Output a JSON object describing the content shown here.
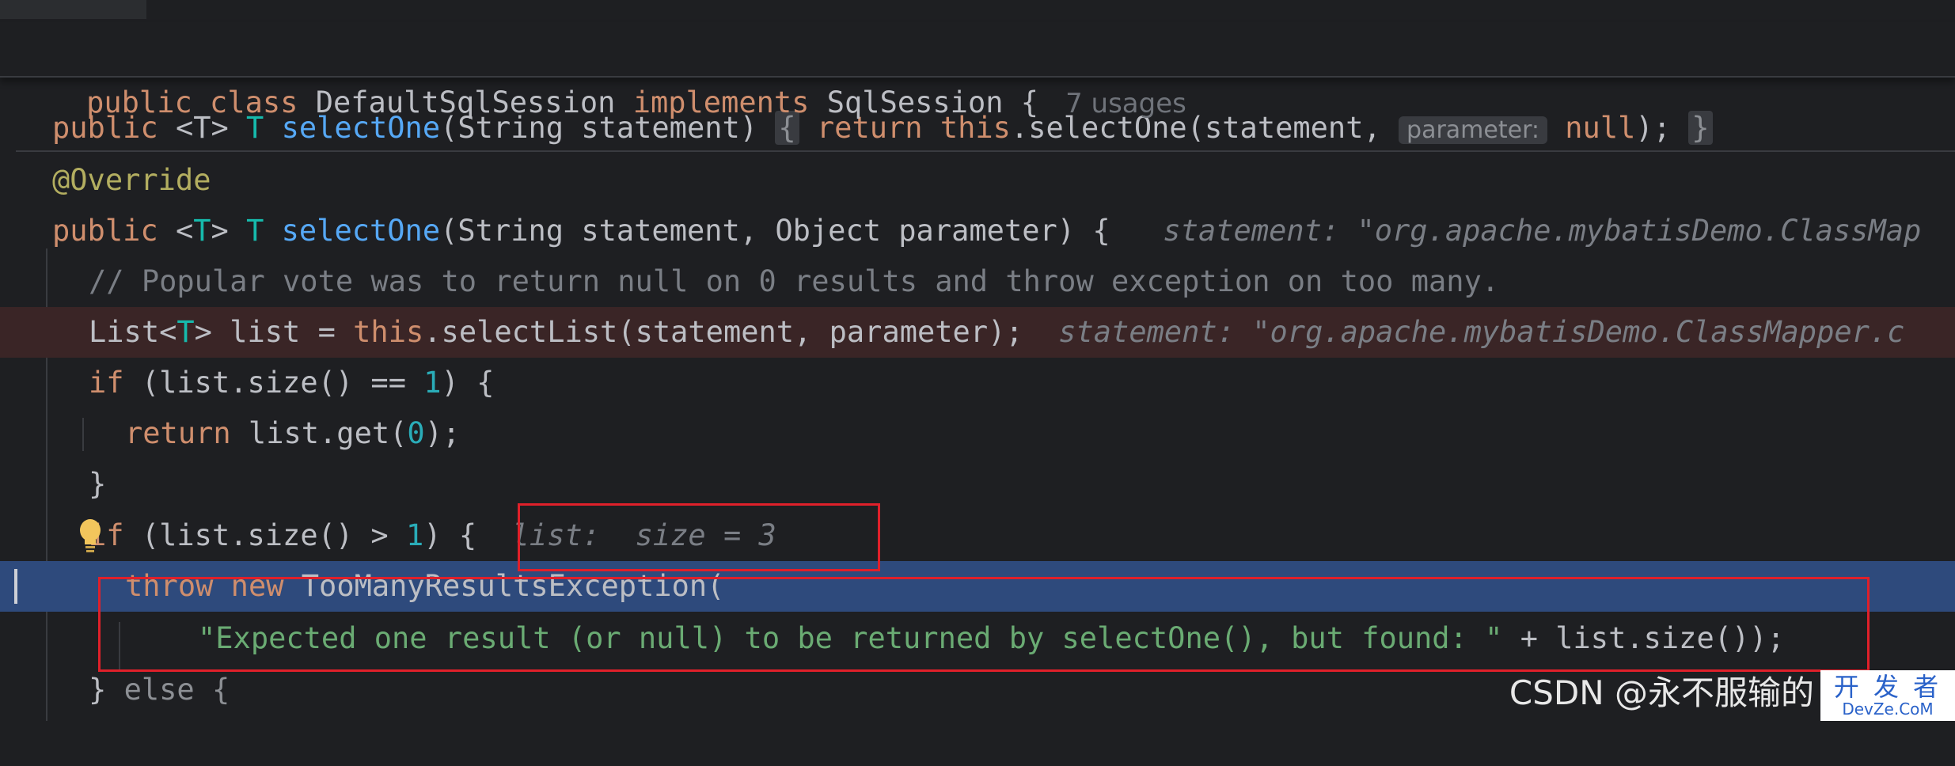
{
  "sticky": {
    "kw_public": "public",
    "kw_class": "class",
    "class_name": "DefaultSqlSession",
    "kw_implements": "implements",
    "interface_name": "SqlSession",
    "brace": "{",
    "usages": "7 usages"
  },
  "partial_line": {
    "public": "public",
    "generic": "<T>",
    "ret": "T",
    "method": "selectOne",
    "params": "(String statement)",
    "fold_open": "{",
    "kw_return": "return",
    "kw_this": "this",
    "call": ".selectOne(statement,",
    "param_hint": "parameter:",
    "kw_null": "null",
    "tail": ");",
    "fold_close": "}"
  },
  "annotation": "@Override",
  "signature": {
    "public": "public",
    "lt": "<",
    "T1": "T",
    "gt": ">",
    "T2": "T",
    "method": "selectOne",
    "params": "(String statement, Object parameter) {",
    "hint": "statement: \"org.apache.mybatisDemo.ClassMap"
  },
  "comment": "// Popular vote was to return null on 0 results and throw exception on too many.",
  "list_line": {
    "list": "List<",
    "T": "T",
    "rest": "> list = ",
    "this": "this",
    "call": ".selectList(statement, parameter);",
    "hint": "statement: \"org.apache.mybatisDemo.ClassMapper.c"
  },
  "if1": {
    "kw": "if",
    "a": " (list.size() == ",
    "n": "1",
    "b": ") {"
  },
  "return_line": {
    "kw": "return",
    "a": " list.get(",
    "n": "0",
    "b": ");"
  },
  "close1": "}",
  "if2": {
    "kw": "if",
    "a": " (list.size() > ",
    "n": "1",
    "b": ") {",
    "hint": "list:  size = 3"
  },
  "throw_line": {
    "kw_throw": "throw",
    "kw_new": "new",
    "cls": "TooManyResultsException("
  },
  "msg_line": {
    "str": "\"Expected one result (or null) to be returned by selectOne(), but found: \"",
    "rest": " + list.size());"
  },
  "else_line": {
    "brace": "}",
    "kw": "else",
    "open": "{"
  },
  "watermark": {
    "text": "CSDN @永不服输的",
    "logo_cn": "开 发 者",
    "logo_en": "DevZe.CoM"
  }
}
